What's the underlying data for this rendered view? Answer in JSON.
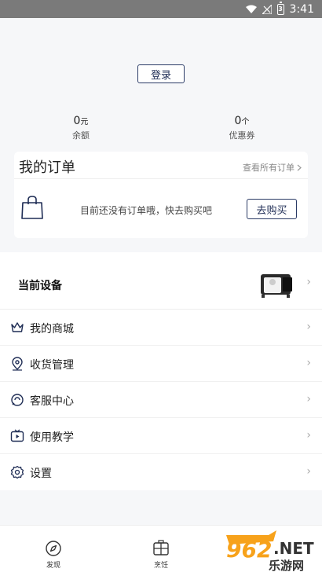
{
  "status_bar": {
    "time": "3:41",
    "battery_level": "3"
  },
  "login": {
    "label": "登录"
  },
  "stats": {
    "balance": {
      "value": "0",
      "unit": "元",
      "label": "余额"
    },
    "coupon": {
      "value": "0",
      "unit": "个",
      "label": "优惠券"
    }
  },
  "orders": {
    "title": "我的订单",
    "view_all": "查看所有订单",
    "empty_text": "目前还没有订单哦，快去购买吧",
    "buy_button": "去购买"
  },
  "device": {
    "label": "当前设备"
  },
  "menu": {
    "items": [
      {
        "label": "我的商城",
        "icon": "crown-icon"
      },
      {
        "label": "收货管理",
        "icon": "location-pin-icon"
      },
      {
        "label": "客服中心",
        "icon": "chat-bubble-icon"
      },
      {
        "label": "使用教学",
        "icon": "tv-play-icon"
      },
      {
        "label": "设置",
        "icon": "gear-icon"
      }
    ]
  },
  "bottom_nav": {
    "tabs": [
      {
        "label": "发现",
        "icon": "compass-icon"
      },
      {
        "label": "烹饪",
        "icon": "cooking-icon"
      }
    ]
  },
  "watermark": {
    "number": "962",
    "suffix": ".NET",
    "text": "乐游网"
  },
  "colors": {
    "accent": "#1f2d55",
    "background": "#f6f7f9",
    "status_bar": "#7a7a7a"
  }
}
